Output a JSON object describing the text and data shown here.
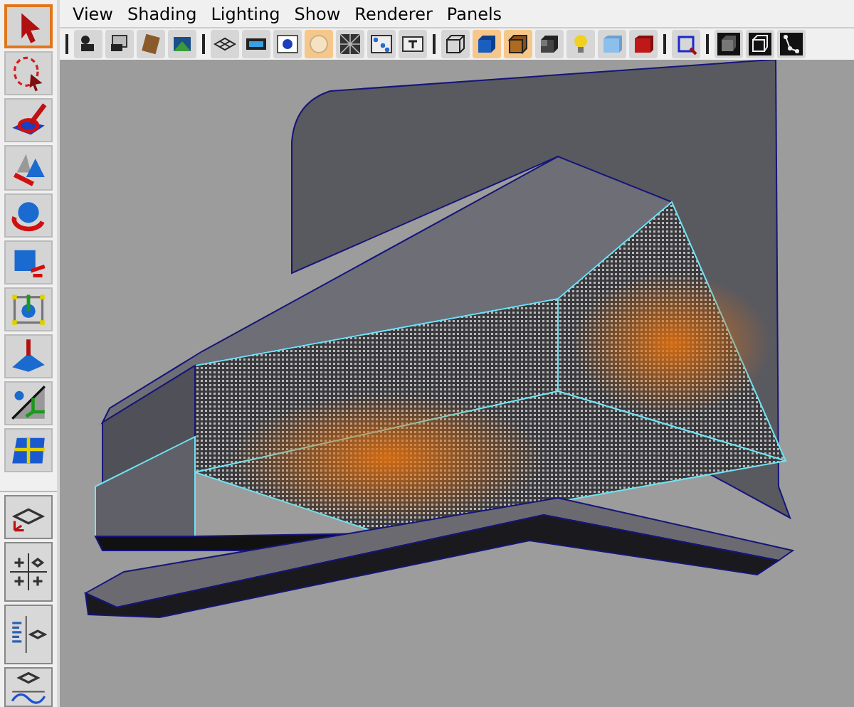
{
  "menu_bar": {
    "items": [
      "View",
      "Shading",
      "Lighting",
      "Show",
      "Renderer",
      "Panels"
    ]
  },
  "panel_toolbar": {
    "buttons": [
      {
        "selected": false
      },
      {
        "selected": false
      },
      {
        "selected": false
      },
      {
        "selected": false
      },
      {
        "selected": false
      },
      {
        "selected": false
      },
      {
        "selected": false
      },
      {
        "selected": true
      },
      {
        "selected": false
      },
      {
        "selected": false
      },
      {
        "selected": false
      },
      {
        "selected": false
      },
      {
        "selected": true
      },
      {
        "selected": true
      },
      {
        "selected": false
      },
      {
        "selected": false
      },
      {
        "selected": false
      },
      {
        "selected": false
      },
      {
        "selected": false
      },
      {
        "selected": false
      },
      {
        "selected": false
      },
      {
        "selected": false
      }
    ]
  },
  "tool_box": {
    "tools": [
      {
        "selected": true
      },
      {
        "selected": false
      },
      {
        "selected": false
      },
      {
        "selected": false
      },
      {
        "selected": false
      },
      {
        "selected": false
      },
      {
        "selected": false
      },
      {
        "selected": false
      },
      {
        "selected": false
      },
      {
        "selected": false
      }
    ]
  },
  "layouts": [
    {
      "selected": false
    },
    {
      "selected": false
    },
    {
      "selected": false
    },
    {
      "selected": false
    }
  ]
}
